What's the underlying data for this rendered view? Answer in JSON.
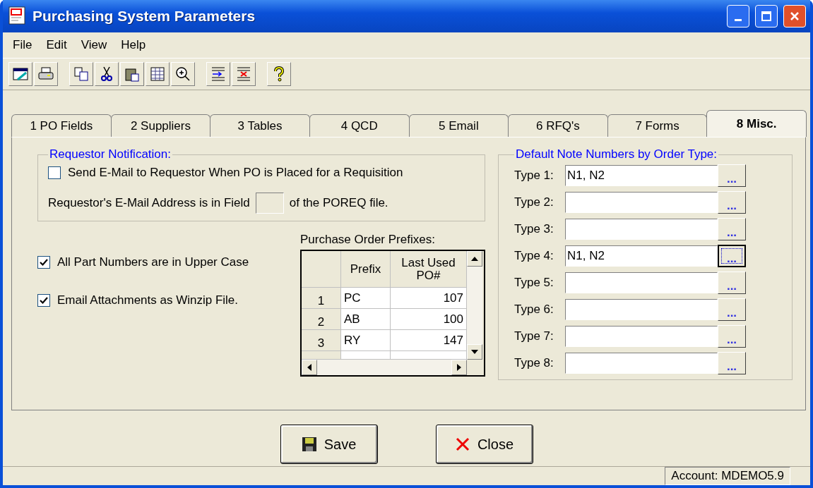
{
  "window": {
    "title": "Purchasing System Parameters"
  },
  "menu": [
    "File",
    "Edit",
    "View",
    "Help"
  ],
  "toolbar": [
    {
      "kind": "grid"
    },
    {
      "kind": "printer"
    },
    {
      "kind": "sep"
    },
    {
      "kind": "copy"
    },
    {
      "kind": "scissors"
    },
    {
      "kind": "clipboard"
    },
    {
      "kind": "table"
    },
    {
      "kind": "zoom"
    },
    {
      "kind": "sep"
    },
    {
      "kind": "insert"
    },
    {
      "kind": "delete"
    },
    {
      "kind": "sep"
    },
    {
      "kind": "question"
    }
  ],
  "tabs": [
    {
      "label": "1 PO Fields",
      "selected": false
    },
    {
      "label": "2 Suppliers",
      "selected": false
    },
    {
      "label": "3 Tables",
      "selected": false
    },
    {
      "label": "4 QCD",
      "selected": false
    },
    {
      "label": "5 Email",
      "selected": false
    },
    {
      "label": "6 RFQ's",
      "selected": false
    },
    {
      "label": "7 Forms",
      "selected": false
    },
    {
      "label": "8 Misc.",
      "selected": true
    }
  ],
  "requestor_notification": {
    "title": "Requestor Notification:",
    "send_email": {
      "label": "Send E-Mail to Requestor When  PO is Placed for a Requisition",
      "checked": false
    },
    "field_before": "Requestor's E-Mail Address is in Field",
    "field_after": "of the POREQ file."
  },
  "options": [
    {
      "label": "All Part Numbers are in Upper Case",
      "checked": true
    },
    {
      "label": "Email Attachments as Winzip File.",
      "checked": true
    }
  ],
  "prefixes": {
    "title": "Purchase Order Prefixes:",
    "columns": [
      "Prefix",
      "Last Used PO#"
    ],
    "rows": [
      {
        "number": "1",
        "prefix": "PC",
        "last_used": "107"
      },
      {
        "number": "2",
        "prefix": "AB",
        "last_used": "100"
      },
      {
        "number": "3",
        "prefix": "RY",
        "last_used": "147"
      }
    ]
  },
  "note_numbers": {
    "title": "Default Note Numbers by Order Type:",
    "rows": [
      {
        "label": "Type 1:",
        "value": "N1, N2",
        "button": "...",
        "focused": false
      },
      {
        "label": "Type 2:",
        "value": "",
        "button": "...",
        "focused": false
      },
      {
        "label": "Type 3:",
        "value": "",
        "button": "...",
        "focused": false
      },
      {
        "label": "Type 4:",
        "value": "N1, N2",
        "button": "...",
        "focused": true
      },
      {
        "label": "Type 5:",
        "value": "",
        "button": "...",
        "focused": false
      },
      {
        "label": "Type 6:",
        "value": "",
        "button": "...",
        "focused": false
      },
      {
        "label": "Type 7:",
        "value": "",
        "button": "...",
        "focused": false
      },
      {
        "label": "Type 8:",
        "value": "",
        "button": "...",
        "focused": false
      }
    ]
  },
  "buttons": [
    {
      "kind": "save",
      "label": "Save"
    },
    {
      "kind": "close",
      "label": "Close"
    }
  ],
  "status_bar": {
    "account": "Account: MDEMO5.9"
  }
}
